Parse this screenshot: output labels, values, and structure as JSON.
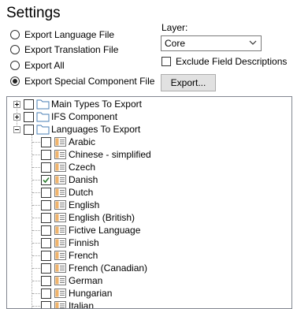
{
  "title": "Settings",
  "export_options": [
    {
      "label": "Export Language File",
      "selected": false
    },
    {
      "label": "Export Translation File",
      "selected": false
    },
    {
      "label": "Export All",
      "selected": false
    },
    {
      "label": "Export Special Component File",
      "selected": true
    }
  ],
  "layer": {
    "label": "Layer:",
    "value": "Core"
  },
  "exclude": {
    "label": "Exclude Field Descriptions",
    "checked": false
  },
  "export_button": "Export...",
  "tree": {
    "roots": [
      {
        "label": "Main Types To Export",
        "expanded": false
      },
      {
        "label": "IFS Component",
        "expanded": false
      },
      {
        "label": "Languages To Export",
        "expanded": true
      }
    ],
    "languages": [
      {
        "label": "Arabic",
        "checked": false
      },
      {
        "label": "Chinese - simplified",
        "checked": false
      },
      {
        "label": "Czech",
        "checked": false
      },
      {
        "label": "Danish",
        "checked": true
      },
      {
        "label": "Dutch",
        "checked": false
      },
      {
        "label": "English",
        "checked": false
      },
      {
        "label": "English (British)",
        "checked": false
      },
      {
        "label": "Fictive Language",
        "checked": false
      },
      {
        "label": "Finnish",
        "checked": false
      },
      {
        "label": "French",
        "checked": false
      },
      {
        "label": "French (Canadian)",
        "checked": false
      },
      {
        "label": "German",
        "checked": false
      },
      {
        "label": "Hungarian",
        "checked": false
      },
      {
        "label": "Italian",
        "checked": false
      }
    ]
  }
}
